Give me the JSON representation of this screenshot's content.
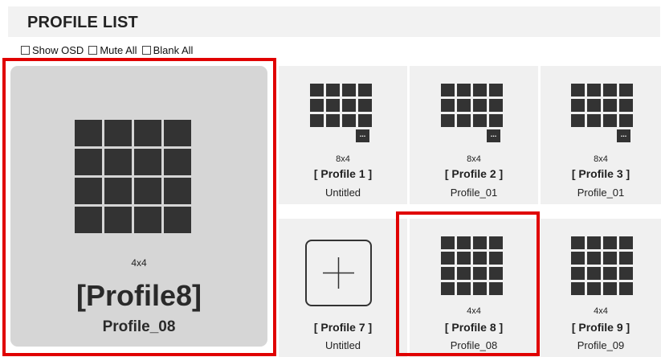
{
  "header": {
    "title": "PROFILE LIST"
  },
  "options": [
    {
      "label": "Show OSD",
      "checked": false
    },
    {
      "label": "Mute All",
      "checked": false
    },
    {
      "label": "Blank All",
      "checked": false
    }
  ],
  "preview": {
    "size": "4x4",
    "name": "[Profile8]",
    "sub": "Profile_08"
  },
  "tiles": [
    {
      "size": "8x4",
      "name": "[ Profile 1 ]",
      "sub": "Untitled",
      "more_icon": "..."
    },
    {
      "size": "8x4",
      "name": "[ Profile 2 ]",
      "sub": "Profile_01",
      "more_icon": "..."
    },
    {
      "size": "8x4",
      "name": "[ Profile 3 ]",
      "sub": "Profile_01",
      "more_icon": "..."
    },
    {
      "size": "",
      "name": "[ Profile 7 ]",
      "sub": "Untitled",
      "icon": "plus-icon"
    },
    {
      "size": "4x4",
      "name": "[ Profile 8 ]",
      "sub": "Profile_08"
    },
    {
      "size": "4x4",
      "name": "[ Profile 9 ]",
      "sub": "Profile_09"
    }
  ],
  "colors": {
    "selection": "#e00000",
    "cell": "#333333",
    "tile_bg": "#f0f0f0",
    "preview_bg": "#d6d6d6"
  }
}
